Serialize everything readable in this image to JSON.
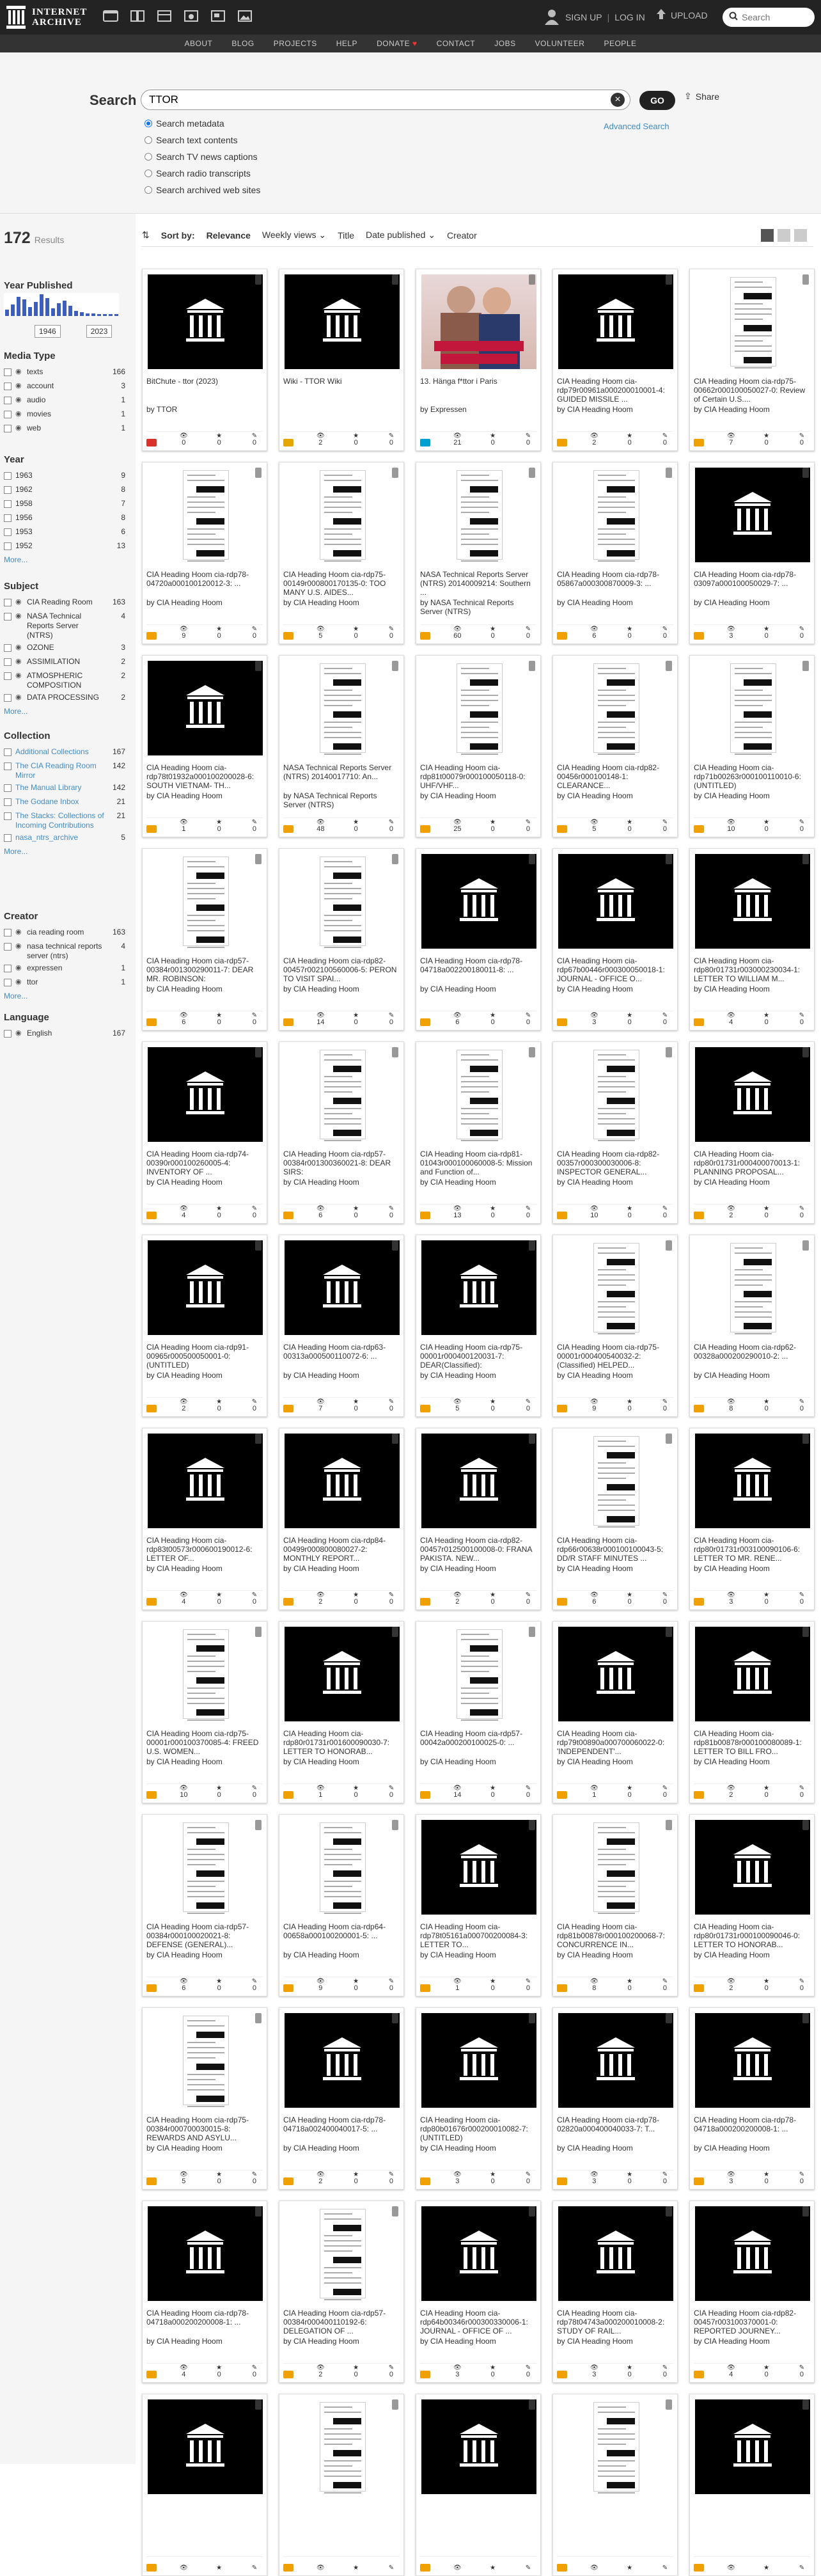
{
  "topbar": {
    "logo_line1": "INTERNET",
    "logo_line2": "ARCHIVE",
    "signup": "SIGN UP",
    "login": "LOG IN",
    "upload": "UPLOAD",
    "search_placeholder": "Search"
  },
  "subnav": [
    "ABOUT",
    "BLOG",
    "PROJECTS",
    "HELP",
    "DONATE",
    "CONTACT",
    "JOBS",
    "VOLUNTEER",
    "PEOPLE"
  ],
  "search": {
    "label": "Search",
    "query": "TTOR",
    "go": "GO",
    "share": "Share",
    "advanced": "Advanced Search",
    "options": [
      "Search metadata",
      "Search text contents",
      "Search TV news captions",
      "Search radio transcripts",
      "Search archived web sites"
    ]
  },
  "sidebar": {
    "count": "172",
    "count_label": "Results",
    "year_published": "Year Published",
    "year_from": "1946",
    "year_to": "2023",
    "media_type_h": "Media Type",
    "media_type": [
      [
        "texts",
        "166"
      ],
      [
        "account",
        "3"
      ],
      [
        "audio",
        "1"
      ],
      [
        "movies",
        "1"
      ],
      [
        "web",
        "1"
      ]
    ],
    "year_h": "Year",
    "year": [
      [
        "1963",
        "9"
      ],
      [
        "1962",
        "8"
      ],
      [
        "1958",
        "7"
      ],
      [
        "1956",
        "8"
      ],
      [
        "1953",
        "6"
      ],
      [
        "1952",
        "13"
      ]
    ],
    "subject_h": "Subject",
    "subject": [
      [
        "CIA Reading Room",
        "163"
      ],
      [
        "NASA Technical Reports Server (NTRS)",
        "4"
      ],
      [
        "OZONE",
        "3"
      ],
      [
        "ASSIMILATION",
        "2"
      ],
      [
        "ATMOSPHERIC COMPOSITION",
        "2"
      ],
      [
        "DATA PROCESSING",
        "2"
      ]
    ],
    "collection_h": "Collection",
    "collection": [
      [
        "Additional Collections",
        "167"
      ],
      [
        "The CIA Reading Room Mirror",
        "142"
      ],
      [
        "The Manual Library",
        "142"
      ],
      [
        "The Godane Inbox",
        "21"
      ],
      [
        "The Stacks: Collections of Incoming Contributions",
        "21"
      ],
      [
        "nasa_ntrs_archive",
        "5"
      ]
    ],
    "creator_h": "Creator",
    "creator": [
      [
        "cia reading room",
        "163"
      ],
      [
        "nasa technical reports server (ntrs)",
        "4"
      ],
      [
        "expressen",
        "1"
      ],
      [
        "ttor",
        "1"
      ]
    ],
    "language_h": "Language",
    "language": [
      [
        "English",
        "167"
      ]
    ],
    "more": "More..."
  },
  "sortbar": {
    "label": "Sort by:",
    "options": [
      "Relevance",
      "Weekly views",
      "Title",
      "Date published",
      "Creator"
    ]
  },
  "items": [
    {
      "title": "BitChute - ttor (2023)",
      "by": "by TTOR",
      "thumb": "black",
      "type": "movies",
      "stats": [
        "0",
        "0",
        "0"
      ]
    },
    {
      "title": "Wiki - TTOR Wiki",
      "by": "",
      "thumb": "black",
      "type": "web",
      "stats": [
        "2",
        "0",
        "0"
      ]
    },
    {
      "title": "13. Hänga f*ttor i Paris",
      "by": "by Expressen",
      "thumb": "poster",
      "type": "audio",
      "stats": [
        "21",
        "0",
        "0"
      ]
    },
    {
      "title": "CIA Heading Hoom cia-rdp79r00961a000200010001-4: GUIDED MISSILE ...",
      "by": "by CIA Heading Hoom",
      "thumb": "black",
      "type": "texts",
      "stats": [
        "2",
        "0",
        "0"
      ]
    },
    {
      "title": "CIA Heading Hoom cia-rdp75-00662r000100050027-0: Review of Certain U.S....",
      "by": "by CIA Heading Hoom",
      "thumb": "doc",
      "type": "texts",
      "stats": [
        "7",
        "0",
        "0"
      ]
    },
    {
      "title": "CIA Heading Hoom cia-rdp78-04720a000100120012-3: ...",
      "by": "by CIA Heading Hoom",
      "thumb": "doc",
      "type": "texts",
      "stats": [
        "9",
        "0",
        "0"
      ]
    },
    {
      "title": "CIA Heading Hoom cia-rdp75-00149r000800170135-0: TOO MANY U.S. AIDES...",
      "by": "by CIA Heading Hoom",
      "thumb": "doc",
      "type": "texts",
      "stats": [
        "5",
        "0",
        "0"
      ]
    },
    {
      "title": "NASA Technical Reports Server (NTRS) 20140009214: Southern ...",
      "by": "by NASA Technical Reports Server (NTRS)",
      "thumb": "doc",
      "type": "texts",
      "stats": [
        "60",
        "0",
        "0"
      ]
    },
    {
      "title": "CIA Heading Hoom cia-rdp78-05867a000300870009-3: ...",
      "by": "by CIA Heading Hoom",
      "thumb": "doc",
      "type": "texts",
      "stats": [
        "6",
        "0",
        "0"
      ]
    },
    {
      "title": "CIA Heading Hoom cia-rdp78-03097a000100050029-7: ...",
      "by": "by CIA Heading Hoom",
      "thumb": "black",
      "type": "texts",
      "stats": [
        "3",
        "0",
        "0"
      ]
    },
    {
      "title": "CIA Heading Hoom cia-rdp78t01932a000100200028-6: SOUTH VIETNAM- TH...",
      "by": "by CIA Heading Hoom",
      "thumb": "black",
      "type": "texts",
      "stats": [
        "1",
        "0",
        "0"
      ]
    },
    {
      "title": "NASA Technical Reports Server (NTRS) 20140017710: An...",
      "by": "by NASA Technical Reports Server (NTRS)",
      "thumb": "doc",
      "type": "texts",
      "stats": [
        "48",
        "0",
        "0"
      ]
    },
    {
      "title": "CIA Heading Hoom cia-rdp81t00079r000100050118-0: UHF/VHF...",
      "by": "by CIA Heading Hoom",
      "thumb": "doc",
      "type": "texts",
      "stats": [
        "25",
        "0",
        "0"
      ]
    },
    {
      "title": "CIA Heading Hoom cia-rdp82-00456r000100148-1: CLEARANCE...",
      "by": "by CIA Heading Hoom",
      "thumb": "doc",
      "type": "texts",
      "stats": [
        "5",
        "0",
        "0"
      ]
    },
    {
      "title": "CIA Heading Hoom cia-rdp71b00263r000100110010-6: (UNTITLED)",
      "by": "by CIA Heading Hoom",
      "thumb": "doc",
      "type": "texts",
      "stats": [
        "10",
        "0",
        "0"
      ]
    },
    {
      "title": "CIA Heading Hoom cia-rdp57-00384r001300290011-7: DEAR MR. ROBINSON:",
      "by": "by CIA Heading Hoom",
      "thumb": "doc",
      "type": "texts",
      "stats": [
        "6",
        "0",
        "0"
      ]
    },
    {
      "title": "CIA Heading Hoom cia-rdp82-00457r002100560006-5: PERON TO VISIT SPAI...",
      "by": "by CIA Heading Hoom",
      "thumb": "doc",
      "type": "texts",
      "stats": [
        "14",
        "0",
        "0"
      ]
    },
    {
      "title": "CIA Heading Hoom cia-rdp78-04718a002200180011-8: ...",
      "by": "by CIA Heading Hoom",
      "thumb": "black",
      "type": "texts",
      "stats": [
        "6",
        "0",
        "0"
      ]
    },
    {
      "title": "CIA Heading Hoom cia-rdp67b00446r000300050018-1: JOURNAL - OFFICE O...",
      "by": "by CIA Heading Hoom",
      "thumb": "black",
      "type": "texts",
      "stats": [
        "3",
        "0",
        "0"
      ]
    },
    {
      "title": "CIA Heading Hoom cia-rdp80r01731r003000230034-1: LETTER TO WILLIAM M...",
      "by": "by CIA Heading Hoom",
      "thumb": "black",
      "type": "texts",
      "stats": [
        "4",
        "0",
        "0"
      ]
    },
    {
      "title": "CIA Heading Hoom cia-rdp74-00390r000100260005-4: INVENTORY OF ...",
      "by": "by CIA Heading Hoom",
      "thumb": "black",
      "type": "texts",
      "stats": [
        "4",
        "0",
        "0"
      ]
    },
    {
      "title": "CIA Heading Hoom cia-rdp57-00384r001300360021-8: DEAR SIRS:",
      "by": "by CIA Heading Hoom",
      "thumb": "doc",
      "type": "texts",
      "stats": [
        "6",
        "0",
        "0"
      ]
    },
    {
      "title": "CIA Heading Hoom cia-rdp81-01043r000100060008-5: Mission and Function of...",
      "by": "by CIA Heading Hoom",
      "thumb": "doc",
      "type": "texts",
      "stats": [
        "13",
        "0",
        "0"
      ]
    },
    {
      "title": "CIA Heading Hoom cia-rdp82-00357r000300030006-8: INSPECTOR GENERAL...",
      "by": "by CIA Heading Hoom",
      "thumb": "doc",
      "type": "texts",
      "stats": [
        "10",
        "0",
        "0"
      ]
    },
    {
      "title": "CIA Heading Hoom cia-rdp80r01731r000400070013-1: PLANNING PROPOSAL...",
      "by": "by CIA Heading Hoom",
      "thumb": "black",
      "type": "texts",
      "stats": [
        "2",
        "0",
        "0"
      ]
    },
    {
      "title": "CIA Heading Hoom cia-rdp91-00965r000500050001-0: (UNTITLED)",
      "by": "by CIA Heading Hoom",
      "thumb": "black",
      "type": "texts",
      "stats": [
        "2",
        "0",
        "0"
      ]
    },
    {
      "title": "CIA Heading Hoom cia-rdp63-00313a000500110072-6: ...",
      "by": "by CIA Heading Hoom",
      "thumb": "black",
      "type": "texts",
      "stats": [
        "7",
        "0",
        "0"
      ]
    },
    {
      "title": "CIA Heading Hoom cia-rdp75-00001r000400120031-7: DEAR(Classified):",
      "by": "by CIA Heading Hoom",
      "thumb": "black",
      "type": "texts",
      "stats": [
        "5",
        "0",
        "0"
      ]
    },
    {
      "title": "CIA Heading Hoom cia-rdp75-00001r000400540032-2: (Classified) HELPED...",
      "by": "by CIA Heading Hoom",
      "thumb": "doc",
      "type": "texts",
      "stats": [
        "9",
        "0",
        "0"
      ]
    },
    {
      "title": "CIA Heading Hoom cia-rdp62-00328a000200290010-2: ...",
      "by": "by CIA Heading Hoom",
      "thumb": "doc",
      "type": "texts",
      "stats": [
        "8",
        "0",
        "0"
      ]
    },
    {
      "title": "CIA Heading Hoom cia-rdp83t00573r000600190012-6: LETTER OF...",
      "by": "by CIA Heading Hoom",
      "thumb": "black",
      "type": "texts",
      "stats": [
        "4",
        "0",
        "0"
      ]
    },
    {
      "title": "CIA Heading Hoom cia-rdp84-00499r000800080027-2: MONTHLY REPORT...",
      "by": "by CIA Heading Hoom",
      "thumb": "black",
      "type": "texts",
      "stats": [
        "2",
        "0",
        "0"
      ]
    },
    {
      "title": "CIA Heading Hoom cia-rdp82-00457r012500100008-0: FRANA PAKISTA. NEW...",
      "by": "by CIA Heading Hoom",
      "thumb": "black",
      "type": "texts",
      "stats": [
        "2",
        "0",
        "0"
      ]
    },
    {
      "title": "CIA Heading Hoom cia-rdp66r00638r000100100043-5: DD/R STAFF MINUTES ...",
      "by": "by CIA Heading Hoom",
      "thumb": "doc",
      "type": "texts",
      "stats": [
        "6",
        "0",
        "0"
      ]
    },
    {
      "title": "CIA Heading Hoom cia-rdp80r01731r003100090106-6: LETTER TO MR. RENE...",
      "by": "by CIA Heading Hoom",
      "thumb": "black",
      "type": "texts",
      "stats": [
        "3",
        "0",
        "0"
      ]
    },
    {
      "title": "CIA Heading Hoom cia-rdp75-00001r000100370085-4: FREED U.S. WOMEN...",
      "by": "by CIA Heading Hoom",
      "thumb": "doc",
      "type": "texts",
      "stats": [
        "10",
        "0",
        "0"
      ]
    },
    {
      "title": "CIA Heading Hoom cia-rdp80r01731r001600090030-7: LETTER TO HONORAB...",
      "by": "by CIA Heading Hoom",
      "thumb": "black",
      "type": "texts",
      "stats": [
        "1",
        "0",
        "0"
      ]
    },
    {
      "title": "CIA Heading Hoom cia-rdp57-00042a000200100025-0: ...",
      "by": "by CIA Heading Hoom",
      "thumb": "doc",
      "type": "texts",
      "stats": [
        "14",
        "0",
        "0"
      ]
    },
    {
      "title": "CIA Heading Hoom cia-rdp79t00890a000700060022-0: 'INDEPENDENT'...",
      "by": "by CIA Heading Hoom",
      "thumb": "black",
      "type": "texts",
      "stats": [
        "1",
        "0",
        "0"
      ]
    },
    {
      "title": "CIA Heading Hoom cia-rdp81b00878r000100080089-1: LETTER TO BILL FRO...",
      "by": "by CIA Heading Hoom",
      "thumb": "black",
      "type": "texts",
      "stats": [
        "2",
        "0",
        "0"
      ]
    },
    {
      "title": "CIA Heading Hoom cia-rdp57-00384r000100020021-8: DEFENSE (GENERAL)...",
      "by": "by CIA Heading Hoom",
      "thumb": "doc",
      "type": "texts",
      "stats": [
        "6",
        "0",
        "0"
      ]
    },
    {
      "title": "CIA Heading Hoom cia-rdp64-00658a000100200001-5: ...",
      "by": "by CIA Heading Hoom",
      "thumb": "doc",
      "type": "texts",
      "stats": [
        "9",
        "0",
        "0"
      ]
    },
    {
      "title": "CIA Heading Hoom cia-rdp78t05161a000700200084-3: LETTER TO...",
      "by": "by CIA Heading Hoom",
      "thumb": "black",
      "type": "texts",
      "stats": [
        "1",
        "0",
        "0"
      ]
    },
    {
      "title": "CIA Heading Hoom cia-rdp81b00878r000100200068-7: CONCURRENCE IN...",
      "by": "by CIA Heading Hoom",
      "thumb": "doc",
      "type": "texts",
      "stats": [
        "8",
        "0",
        "0"
      ]
    },
    {
      "title": "CIA Heading Hoom cia-rdp80r01731r000100090046-0: LETTER TO HONORAB...",
      "by": "by CIA Heading Hoom",
      "thumb": "black",
      "type": "texts",
      "stats": [
        "2",
        "0",
        "0"
      ]
    },
    {
      "title": "CIA Heading Hoom cia-rdp75-00384r000700030015-8: REWARDS AND ASYLU...",
      "by": "by CIA Heading Hoom",
      "thumb": "doc",
      "type": "texts",
      "stats": [
        "5",
        "0",
        "0"
      ]
    },
    {
      "title": "CIA Heading Hoom cia-rdp78-04718a002400040017-5: ...",
      "by": "by CIA Heading Hoom",
      "thumb": "black",
      "type": "texts",
      "stats": [
        "2",
        "0",
        "0"
      ]
    },
    {
      "title": "CIA Heading Hoom cia-rdp80b01676r000200010082-7: (UNTITLED)",
      "by": "by CIA Heading Hoom",
      "thumb": "black",
      "type": "texts",
      "stats": [
        "3",
        "0",
        "0"
      ]
    },
    {
      "title": "CIA Heading Hoom cia-rdp78-02820a000400040033-7: T...",
      "by": "by CIA Heading Hoom",
      "thumb": "black",
      "type": "texts",
      "stats": [
        "3",
        "0",
        "0"
      ]
    },
    {
      "title": "CIA Heading Hoom cia-rdp78-04718a000200200008-1: ...",
      "by": "by CIA Heading Hoom",
      "thumb": "black",
      "type": "texts",
      "stats": [
        "3",
        "0",
        "0"
      ]
    },
    {
      "title": "CIA Heading Hoom cia-rdp78-04718a000200200008-1: ...",
      "by": "by CIA Heading Hoom",
      "thumb": "black",
      "type": "texts",
      "stats": [
        "4",
        "0",
        "0"
      ]
    },
    {
      "title": "CIA Heading Hoom cia-rdp57-00384r000400110192-6: DELEGATION OF ...",
      "by": "by CIA Heading Hoom",
      "thumb": "doc",
      "type": "texts",
      "stats": [
        "2",
        "0",
        "0"
      ]
    },
    {
      "title": "CIA Heading Hoom cia-rdp64b00346r000300330006-1: JOURNAL - OFFICE OF ...",
      "by": "by CIA Heading Hoom",
      "thumb": "black",
      "type": "texts",
      "stats": [
        "3",
        "0",
        "0"
      ]
    },
    {
      "title": "CIA Heading Hoom cia-rdp78t04743a000200010008-2: STUDY OF RAIL...",
      "by": "by CIA Heading Hoom",
      "thumb": "black",
      "type": "texts",
      "stats": [
        "3",
        "0",
        "0"
      ]
    },
    {
      "title": "CIA Heading Hoom cia-rdp82-00457r003100370001-0: REPORTED JOURNEY...",
      "by": "by CIA Heading Hoom",
      "thumb": "black",
      "type": "texts",
      "stats": [
        "4",
        "0",
        "0"
      ]
    },
    {
      "title": "",
      "by": "",
      "thumb": "black",
      "type": "texts",
      "stats": [
        "",
        "",
        ""
      ]
    },
    {
      "title": "",
      "by": "",
      "thumb": "doc",
      "type": "texts",
      "stats": [
        "",
        "",
        ""
      ]
    },
    {
      "title": "",
      "by": "",
      "thumb": "black",
      "type": "texts",
      "stats": [
        "",
        "",
        ""
      ]
    },
    {
      "title": "",
      "by": "",
      "thumb": "doc",
      "type": "texts",
      "stats": [
        "",
        "",
        ""
      ]
    },
    {
      "title": "",
      "by": "",
      "thumb": "black",
      "type": "texts",
      "stats": [
        "",
        "",
        ""
      ]
    }
  ]
}
